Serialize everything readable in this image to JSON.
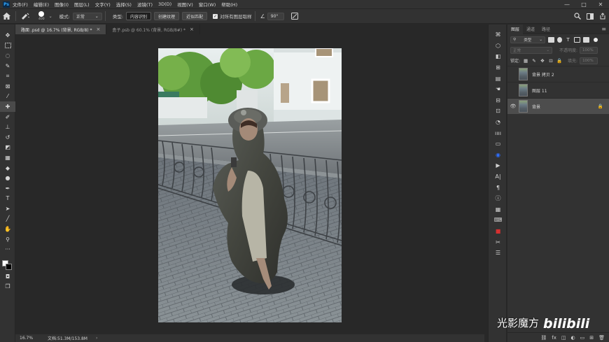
{
  "menubar": {
    "logo": "Ps",
    "items": [
      "文件(F)",
      "编辑(E)",
      "图像(I)",
      "图层(L)",
      "文字(Y)",
      "选择(S)",
      "滤镜(T)",
      "3D(D)",
      "视图(V)",
      "窗口(W)",
      "帮助(H)"
    ],
    "controls": [
      "—",
      "□",
      "✕"
    ]
  },
  "options": {
    "brush_size": "400",
    "mode_label": "模式:",
    "mode_value": "正常",
    "type_label": "类型:",
    "type_buttons": [
      "内容识别",
      "创建纹理",
      "近似匹配"
    ],
    "sample_all_label": "对所有图层取样",
    "angle_value": "90°"
  },
  "tabs": [
    {
      "label": "路面 .psd @ 16.7% (背景, RGB/8) *",
      "close": "×"
    },
    {
      "label": "盒子.psb @ 60.1% (背景, RGB/8#) *",
      "close": "×"
    }
  ],
  "status": {
    "zoom": "16.7%",
    "doc_info": "文档:51.3M/153.8M",
    "arrow": "›"
  },
  "layers_panel": {
    "tabs": [
      "图层",
      "通道",
      "路径"
    ],
    "filter_value": "类型",
    "blend_mode": "正常",
    "opacity_label": "不透明度:",
    "opacity_value": "100%",
    "lock_label": "锁定:",
    "fill_label": "填充:",
    "fill_value": "100%",
    "layers": [
      {
        "name": "背景 拷贝 2",
        "visible": false,
        "selected": false
      },
      {
        "name": "图层 11",
        "visible": false,
        "selected": false
      },
      {
        "name": "背景",
        "visible": true,
        "selected": true,
        "locked": true
      }
    ],
    "footer_icons": [
      "link-icon",
      "fx-icon",
      "mask-icon",
      "adjustment-icon",
      "folder-icon",
      "new-layer-icon",
      "trash-icon"
    ]
  },
  "watermark": {
    "text": "光影魔方",
    "logo_text": "bilibili"
  }
}
